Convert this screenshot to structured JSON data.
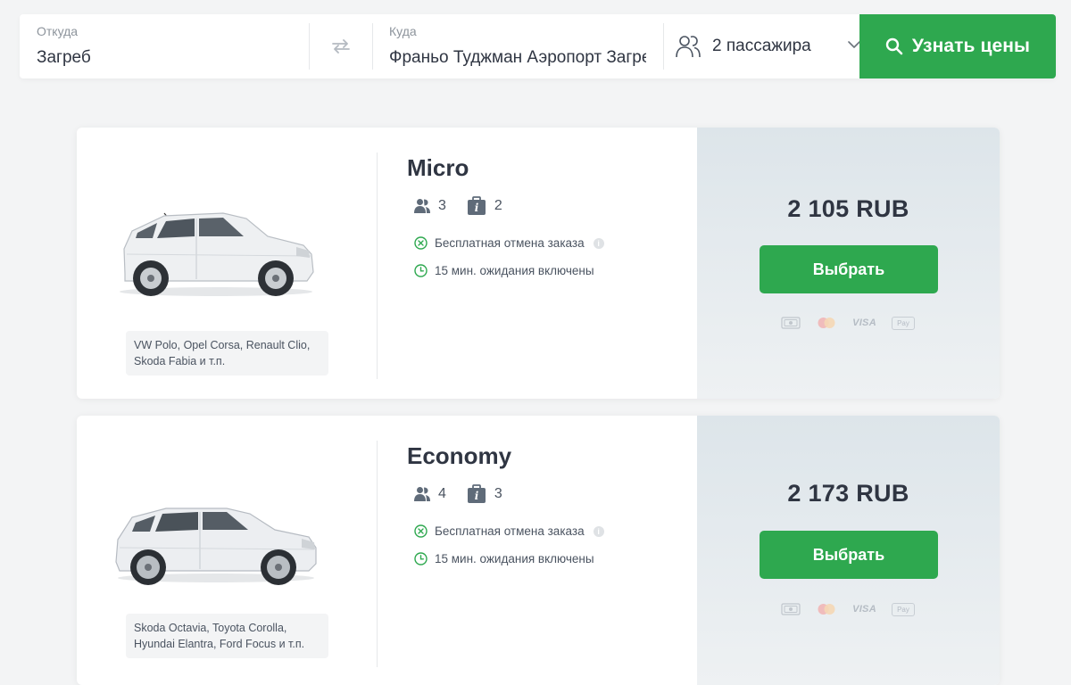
{
  "search": {
    "from_label": "Откуда",
    "from_value": "Загреб",
    "to_label": "Куда",
    "to_value": "Франьо Туджман Аэропорт Загреб",
    "passengers_label": "2 пассажира",
    "button_label": "Узнать цены"
  },
  "results": [
    {
      "class_name": "Micro",
      "passengers": "3",
      "luggage": "2",
      "feature_cancel": "Бесплатная отмена заказа",
      "feature_wait": "15 мин. ожидания включены",
      "models": "VW Polo, Opel Corsa, Renault Clio, Skoda Fabia и т.п.",
      "price": "2 105 RUB",
      "select_label": "Выбрать",
      "payment_visa": "VISA",
      "payment_apple": "Pay"
    },
    {
      "class_name": "Economy",
      "passengers": "4",
      "luggage": "3",
      "feature_cancel": "Бесплатная отмена заказа",
      "feature_wait": "15 мин. ожидания включены",
      "models": "Skoda Octavia, Toyota Corolla, Hyundai Elantra, Ford Focus и т.п.",
      "price": "2 173 RUB",
      "select_label": "Выбрать",
      "payment_visa": "VISA",
      "payment_apple": "Pay"
    }
  ],
  "colors": {
    "accent_green": "#2ea84f",
    "text_dark": "#2f3542",
    "price_pane": "#dde5ea"
  },
  "icons": [
    "swap-arrows-icon",
    "passengers-icon",
    "chevron-down-icon",
    "search-icon",
    "passenger-seat-icon",
    "luggage-icon",
    "cancel-circle-icon",
    "clock-icon",
    "info-icon",
    "cash-icon",
    "mastercard-icon",
    "visa-icon",
    "apple-pay-icon"
  ]
}
